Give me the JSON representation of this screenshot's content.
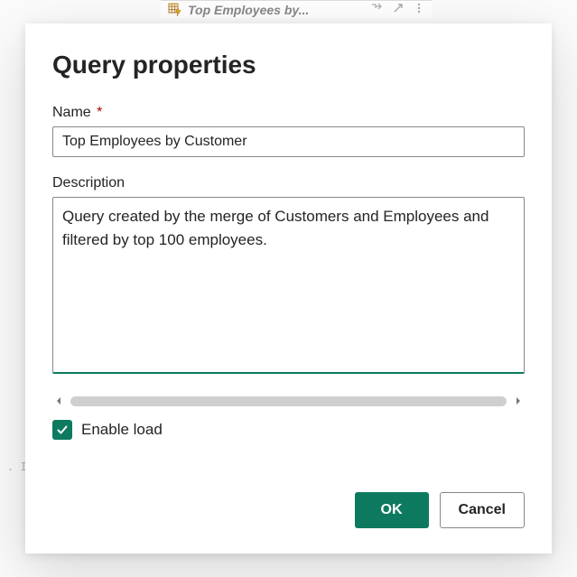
{
  "background": {
    "tab_title": "Top Employees by...",
    "left_marker": ". I"
  },
  "dialog": {
    "title": "Query properties",
    "name": {
      "label": "Name",
      "required_mark": "*",
      "value": "Top Employees by Customer"
    },
    "description": {
      "label": "Description",
      "value": "Query created by the merge of Customers and Employees and filtered by top 100 employees."
    },
    "enable_load": {
      "label": "Enable load",
      "checked": true
    },
    "buttons": {
      "ok": "OK",
      "cancel": "Cancel"
    }
  }
}
